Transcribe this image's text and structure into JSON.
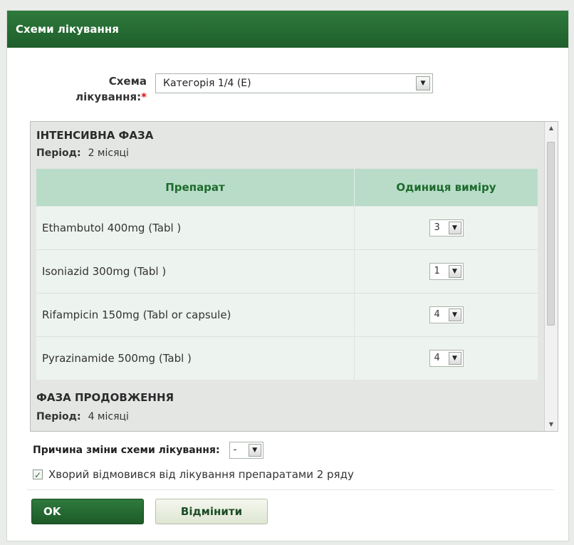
{
  "dialog": {
    "title": "Схеми лікування"
  },
  "scheme": {
    "label_line1": "Схема",
    "label_line2": "лікування:",
    "required_mark": "*",
    "selected": "Категорія 1/4 (E)"
  },
  "intensive_phase": {
    "title": "ІНТЕНСИВНА ФАЗА",
    "period_label": "Період:",
    "period_value": "2 місяці"
  },
  "table": {
    "headers": [
      "Препарат",
      "Одиниця виміру"
    ],
    "rows": [
      {
        "drug": "Ethambutol 400mg (Tabl )",
        "unit": "3"
      },
      {
        "drug": "Isoniazid 300mg (Tabl )",
        "unit": "1"
      },
      {
        "drug": "Rifampicin 150mg (Tabl or capsule)",
        "unit": "4"
      },
      {
        "drug": "Pyrazinamide 500mg (Tabl )",
        "unit": "4"
      }
    ]
  },
  "continuation_phase": {
    "title": "ФАЗА ПРОДОВЖЕННЯ",
    "period_label": "Період:",
    "period_value": "4 місяці"
  },
  "reason": {
    "label": "Причина зміни схеми лікування:",
    "selected": "-"
  },
  "refusal": {
    "label": "Хворий відмовився від лікування препаратами 2 ряду",
    "checked": true
  },
  "buttons": {
    "ok": "OK",
    "cancel": "Відмінити"
  },
  "icons": {
    "dropdown": "chevron-down-icon",
    "check": "checkmark-icon"
  },
  "colors": {
    "title_bar": "#1f5e2b",
    "table_header": "#b9dcc9",
    "header_text": "#1d6b2c",
    "ok_button": "#2f7a3d"
  }
}
